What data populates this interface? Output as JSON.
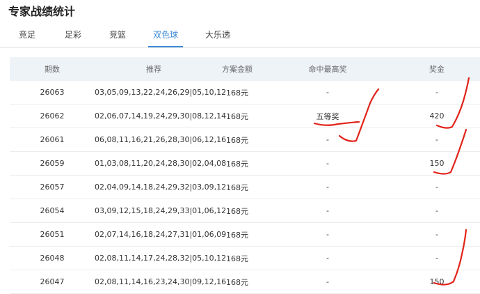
{
  "page": {
    "title": "专家战绩统计"
  },
  "tabs": [
    {
      "label": "竞足",
      "active": false
    },
    {
      "label": "足彩",
      "active": false
    },
    {
      "label": "竞篮",
      "active": false
    },
    {
      "label": "双色球",
      "active": true
    },
    {
      "label": "大乐透",
      "active": false
    }
  ],
  "table": {
    "headers": [
      "期数",
      "推荐",
      "方案金额",
      "命中最高奖",
      "奖金"
    ],
    "rows": [
      {
        "issue": "26063",
        "pick": "03,05,09,13,22,24,26,29|05,10,12",
        "amount": "168元",
        "prize_level": "-",
        "bonus": "-"
      },
      {
        "issue": "26062",
        "pick": "02,06,07,14,19,24,29,30|08,12,14",
        "amount": "168元",
        "prize_level": "五等奖",
        "bonus": "420"
      },
      {
        "issue": "26061",
        "pick": "06,08,11,16,21,26,28,30|06,12,16",
        "amount": "168元",
        "prize_level": "-",
        "bonus": "-"
      },
      {
        "issue": "26059",
        "pick": "01,03,08,11,20,24,28,30|02,04,08",
        "amount": "168元",
        "prize_level": "-",
        "bonus": "150"
      },
      {
        "issue": "26057",
        "pick": "02,04,09,14,18,24,29,32|03,09,12",
        "amount": "168元",
        "prize_level": "-",
        "bonus": "-"
      },
      {
        "issue": "26054",
        "pick": "03,09,12,15,18,24,29,33|01,06,12",
        "amount": "168元",
        "prize_level": "-",
        "bonus": "-"
      },
      {
        "issue": "26051",
        "pick": "02,07,14,16,18,24,27,31|01,06,09",
        "amount": "168元",
        "prize_level": "-",
        "bonus": "-"
      },
      {
        "issue": "26048",
        "pick": "02,08,11,14,17,24,28,32|05,10,12",
        "amount": "168元",
        "prize_level": "-",
        "bonus": "-"
      },
      {
        "issue": "26047",
        "pick": "02,08,11,14,16,23,24,30|09,12,16",
        "amount": "168元",
        "prize_level": "-",
        "bonus": "150"
      }
    ]
  },
  "annotations": {
    "stroke_color": "#e2231a"
  }
}
